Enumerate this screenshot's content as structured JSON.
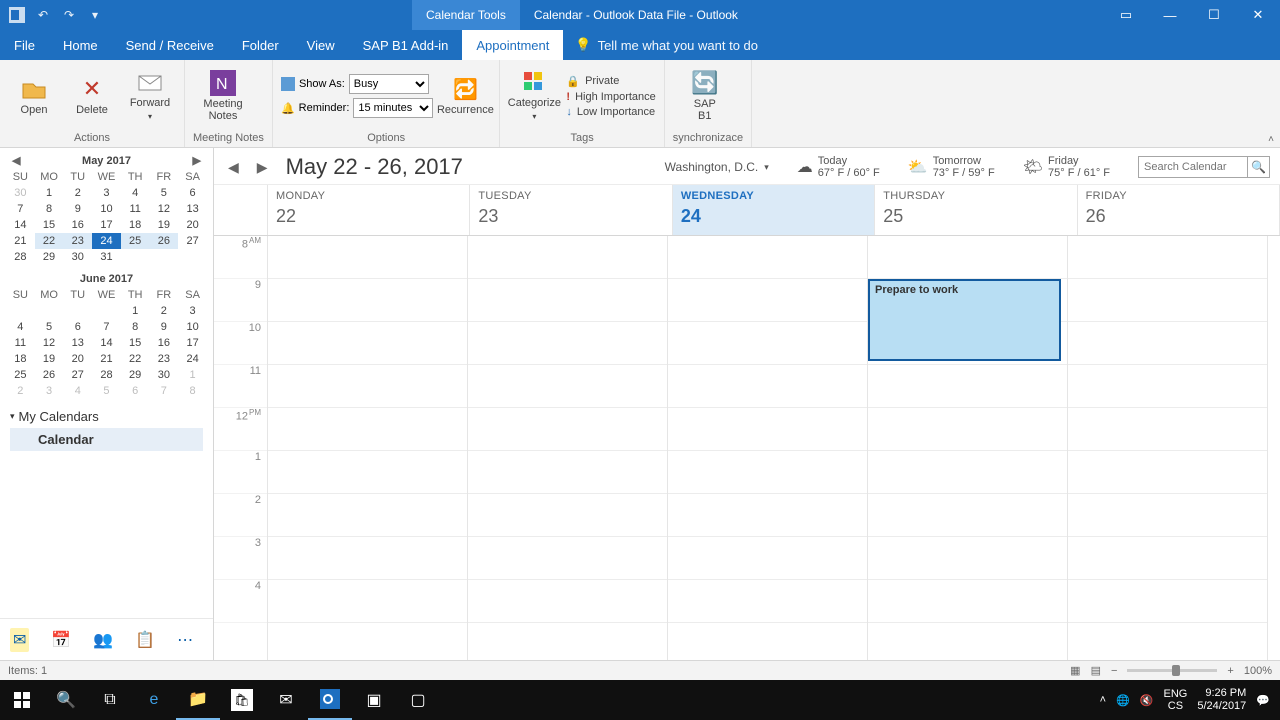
{
  "title": {
    "context": "Calendar Tools",
    "text": "Calendar - Outlook Data File  -  Outlook"
  },
  "tabs": {
    "file": "File",
    "home": "Home",
    "sendrecv": "Send / Receive",
    "folder": "Folder",
    "view": "View",
    "sap": "SAP B1 Add-in",
    "appointment": "Appointment"
  },
  "tellme": "Tell me what you want to do",
  "ribbon": {
    "actions": {
      "open": "Open",
      "delete": "Delete",
      "forward": "Forward",
      "label": "Actions"
    },
    "notes": {
      "btn": "Meeting\nNotes",
      "label": "Meeting Notes"
    },
    "options": {
      "showas_lbl": "Show As:",
      "showas_val": "Busy",
      "reminder_lbl": "Reminder:",
      "reminder_val": "15 minutes",
      "recurrence": "Recurrence",
      "label": "Options"
    },
    "categorize": "Categorize",
    "tags": {
      "private": "Private",
      "high": "High Importance",
      "low": "Low Importance",
      "label": "Tags"
    },
    "sap": {
      "l1": "SAP",
      "l2": "B1",
      "label": "synchronizace"
    }
  },
  "minical1": {
    "title": "May 2017",
    "dow": [
      "SU",
      "MO",
      "TU",
      "WE",
      "TH",
      "FR",
      "SA"
    ],
    "rows": [
      [
        {
          "d": "30",
          "dim": true
        },
        {
          "d": "1"
        },
        {
          "d": "2"
        },
        {
          "d": "3"
        },
        {
          "d": "4"
        },
        {
          "d": "5"
        },
        {
          "d": "6"
        }
      ],
      [
        {
          "d": "7"
        },
        {
          "d": "8"
        },
        {
          "d": "9"
        },
        {
          "d": "10"
        },
        {
          "d": "11"
        },
        {
          "d": "12"
        },
        {
          "d": "13"
        }
      ],
      [
        {
          "d": "14"
        },
        {
          "d": "15"
        },
        {
          "d": "16"
        },
        {
          "d": "17"
        },
        {
          "d": "18"
        },
        {
          "d": "19"
        },
        {
          "d": "20"
        }
      ],
      [
        {
          "d": "21"
        },
        {
          "d": "22",
          "hl": true
        },
        {
          "d": "23",
          "hl": true
        },
        {
          "d": "24",
          "today": true
        },
        {
          "d": "25",
          "hl": true
        },
        {
          "d": "26",
          "hl": true
        },
        {
          "d": "27"
        }
      ],
      [
        {
          "d": "28"
        },
        {
          "d": "29"
        },
        {
          "d": "30"
        },
        {
          "d": "31"
        },
        {
          "d": "",
          "dim": true
        },
        {
          "d": "",
          "dim": true
        },
        {
          "d": "",
          "dim": true
        }
      ]
    ]
  },
  "minical2": {
    "title": "June 2017",
    "dow": [
      "SU",
      "MO",
      "TU",
      "WE",
      "TH",
      "FR",
      "SA"
    ],
    "rows": [
      [
        {
          "d": "",
          "dim": true
        },
        {
          "d": "",
          "dim": true
        },
        {
          "d": "",
          "dim": true
        },
        {
          "d": "",
          "dim": true
        },
        {
          "d": "1"
        },
        {
          "d": "2"
        },
        {
          "d": "3"
        }
      ],
      [
        {
          "d": "4"
        },
        {
          "d": "5"
        },
        {
          "d": "6"
        },
        {
          "d": "7"
        },
        {
          "d": "8"
        },
        {
          "d": "9"
        },
        {
          "d": "10"
        }
      ],
      [
        {
          "d": "11"
        },
        {
          "d": "12"
        },
        {
          "d": "13"
        },
        {
          "d": "14"
        },
        {
          "d": "15"
        },
        {
          "d": "16"
        },
        {
          "d": "17"
        }
      ],
      [
        {
          "d": "18"
        },
        {
          "d": "19"
        },
        {
          "d": "20"
        },
        {
          "d": "21"
        },
        {
          "d": "22"
        },
        {
          "d": "23"
        },
        {
          "d": "24"
        }
      ],
      [
        {
          "d": "25"
        },
        {
          "d": "26"
        },
        {
          "d": "27"
        },
        {
          "d": "28"
        },
        {
          "d": "29"
        },
        {
          "d": "30"
        },
        {
          "d": "1",
          "dim": true
        }
      ],
      [
        {
          "d": "2",
          "dim": true
        },
        {
          "d": "3",
          "dim": true
        },
        {
          "d": "4",
          "dim": true
        },
        {
          "d": "5",
          "dim": true
        },
        {
          "d": "6",
          "dim": true
        },
        {
          "d": "7",
          "dim": true
        },
        {
          "d": "8",
          "dim": true
        }
      ]
    ]
  },
  "mycals": {
    "header": "My Calendars",
    "item": "Calendar"
  },
  "calendar": {
    "range": "May 22 - 26, 2017",
    "location": "Washington,  D.C.",
    "weather": [
      {
        "label": "Today",
        "temp": "67° F / 60° F"
      },
      {
        "label": "Tomorrow",
        "temp": "73° F / 59° F"
      },
      {
        "label": "Friday",
        "temp": "75° F / 61° F"
      }
    ],
    "search_placeholder": "Search Calendar",
    "days": [
      {
        "name": "MONDAY",
        "num": "22"
      },
      {
        "name": "TUESDAY",
        "num": "23"
      },
      {
        "name": "WEDNESDAY",
        "num": "24",
        "today": true
      },
      {
        "name": "THURSDAY",
        "num": "25"
      },
      {
        "name": "FRIDAY",
        "num": "26"
      }
    ],
    "hours": [
      "8",
      "9",
      "10",
      "11",
      "12",
      "1",
      "2",
      "3",
      "4"
    ],
    "hours_suffix": [
      "AM",
      "",
      "",
      "",
      "PM",
      "",
      "",
      "",
      ""
    ],
    "appointment": {
      "title": "Prepare to work",
      "day_index": 3,
      "start_row": 1,
      "rows": 2
    }
  },
  "status": {
    "items": "Items: 1",
    "zoom": "100%"
  },
  "tray": {
    "lang1": "ENG",
    "lang2": "CS",
    "time": "9:26 PM",
    "date": "5/24/2017"
  }
}
